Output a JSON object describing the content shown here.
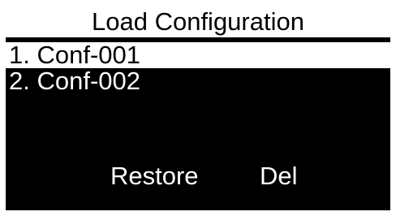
{
  "screen": {
    "title": "Load Configuration"
  },
  "configurations": [
    {
      "label": "1. Conf-001",
      "selected": true
    },
    {
      "label": "2. Conf-002",
      "selected": false
    }
  ],
  "softkeys": {
    "restore_label": "Restore",
    "delete_label": "Del"
  },
  "colors": {
    "background": "#000000",
    "foreground": "#ffffff",
    "highlight": "#ffffff",
    "highlight_text": "#000000"
  }
}
